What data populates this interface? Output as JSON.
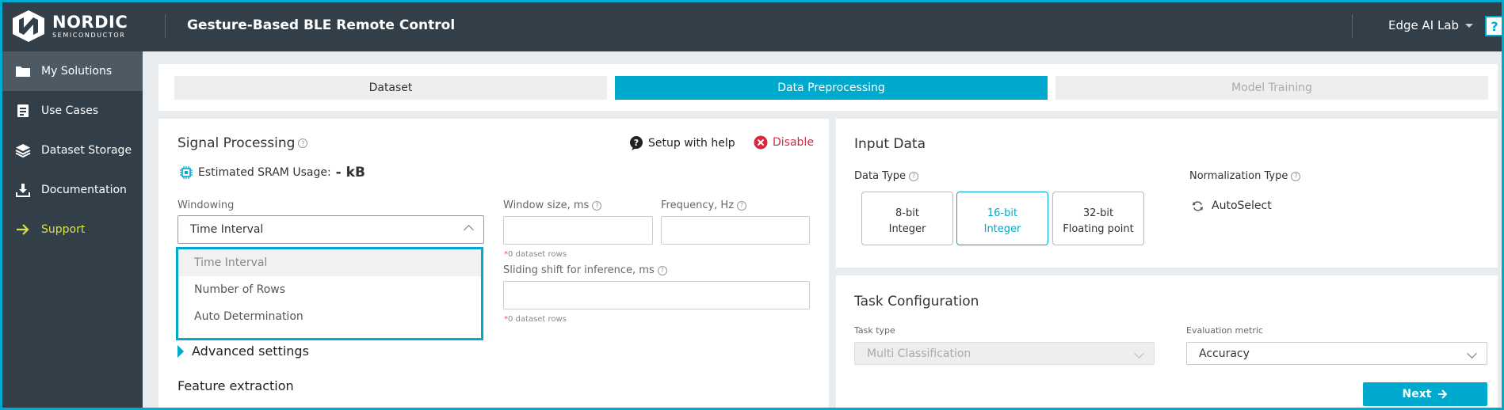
{
  "topbar": {
    "logo_main": "NORDIC",
    "logo_sub": "SEMICONDUCTOR",
    "title": "Gesture-Based BLE Remote Control",
    "workspace": "Edge AI Lab",
    "help": "?"
  },
  "sidebar": {
    "items": [
      {
        "label": "My Solutions"
      },
      {
        "label": "Use Cases"
      },
      {
        "label": "Dataset Storage"
      },
      {
        "label": "Documentation"
      },
      {
        "label": "Support"
      }
    ]
  },
  "stepper": {
    "steps": [
      {
        "label": "Dataset"
      },
      {
        "label": "Data Preprocessing"
      },
      {
        "label": "Model Training"
      }
    ]
  },
  "signal": {
    "title": "Signal Processing",
    "setup_help": "Setup with help",
    "disable": "Disable",
    "sram_label": "Estimated SRAM Usage:",
    "sram_value": "- kB",
    "windowing_label": "Windowing",
    "windowing_value": "Time Interval",
    "window_size_label": "Window size, ms",
    "frequency_label": "Frequency, Hz",
    "rows_note": "0 dataset rows",
    "sliding_label": "Sliding shift for inference, ms",
    "rows_note2": "0 dataset rows",
    "advanced": "Advanced settings",
    "feature_title": "Feature extraction",
    "options": [
      "Time Interval",
      "Number of Rows",
      "Auto Determination"
    ]
  },
  "input_data": {
    "title": "Input Data",
    "data_type_label": "Data Type",
    "types": [
      {
        "line1": "8-bit",
        "line2": "Integer"
      },
      {
        "line1": "16-bit",
        "line2": "Integer"
      },
      {
        "line1": "32-bit",
        "line2": "Floating point"
      }
    ],
    "norm_label": "Normalization Type",
    "norm_value": "AutoSelect"
  },
  "task": {
    "title": "Task Configuration",
    "task_type_label": "Task type",
    "task_type_value": "Multi Classification",
    "metric_label": "Evaluation metric",
    "metric_value": "Accuracy",
    "next": "Next"
  },
  "colors": {
    "accent": "#00a9ce",
    "dark": "#333f48",
    "danger": "#d9283e",
    "support": "#d8e04a"
  }
}
